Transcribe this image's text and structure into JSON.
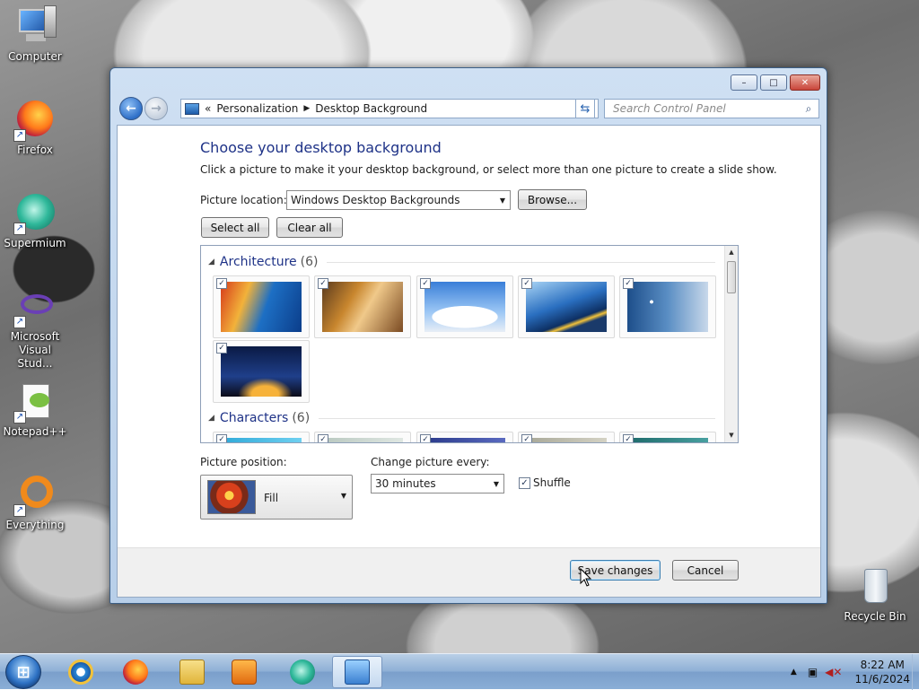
{
  "desktop_icons": [
    {
      "label": "Computer",
      "icon": "computer-icon",
      "shortcut": false
    },
    {
      "label": "Firefox",
      "icon": "firefox-icon",
      "shortcut": true
    },
    {
      "label": "Supermium",
      "icon": "supermium-icon",
      "shortcut": true
    },
    {
      "label": "Microsoft Visual Stud...",
      "icon": "visual-studio-icon",
      "shortcut": true
    },
    {
      "label": "Notepad++",
      "icon": "notepadpp-icon",
      "shortcut": true
    },
    {
      "label": "Everything",
      "icon": "everything-icon",
      "shortcut": true
    },
    {
      "label": "Recycle Bin",
      "icon": "recycle-bin-icon",
      "shortcut": false
    }
  ],
  "window": {
    "controls": {
      "minimize": "–",
      "maximize": "□",
      "close": "✕"
    },
    "address": {
      "root_glyph": "«",
      "crumbs": [
        "Personalization",
        "Desktop Background"
      ],
      "separator": "▶"
    },
    "search_placeholder": "Search Control Panel"
  },
  "page": {
    "title": "Choose your desktop background",
    "description": "Click a picture to make it your desktop background, or select more than one picture to create a slide show.",
    "picture_location_label": "Picture location:",
    "picture_location_value": "Windows Desktop Backgrounds",
    "browse_label": "Browse...",
    "select_all_label": "Select all",
    "clear_all_label": "Clear all"
  },
  "gallery": {
    "groups": [
      {
        "name": "Architecture",
        "count": "(6)",
        "checked": "✓"
      },
      {
        "name": "Characters",
        "count": "(6)",
        "checked": "✓"
      }
    ]
  },
  "options": {
    "position_label": "Picture position:",
    "position_value": "Fill",
    "interval_label": "Change picture every:",
    "interval_value": "30 minutes",
    "shuffle_label": "Shuffle",
    "shuffle_checked": true
  },
  "footer": {
    "save_label": "Save changes",
    "cancel_label": "Cancel"
  },
  "taskbar": {
    "apps": [
      "internet-explorer-icon",
      "firefox-icon",
      "file-explorer-icon",
      "media-player-icon",
      "supermium-icon",
      "control-panel-icon"
    ],
    "time": "8:22 AM",
    "date": "11/6/2024"
  }
}
